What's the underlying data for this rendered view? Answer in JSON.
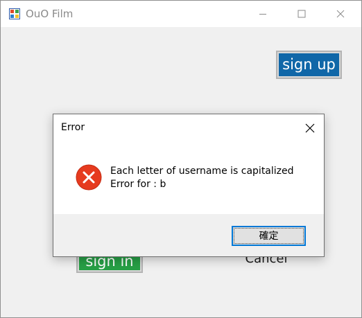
{
  "window": {
    "title": "OuO Film",
    "icon": "app-window-icon"
  },
  "main": {
    "signup_label": "sign up",
    "signin_label": "sign in",
    "cancel_label": "Cancel"
  },
  "dialog": {
    "title": "Error",
    "message_line1": "Each letter of username is capitalized",
    "message_line2": "Error for : b",
    "ok_label": "確定",
    "icon": "error-icon"
  },
  "colors": {
    "signup_bg": "#1067a8",
    "signin_bg": "#27a046",
    "error_red": "#e63b1f",
    "focus_blue": "#0078d7"
  }
}
